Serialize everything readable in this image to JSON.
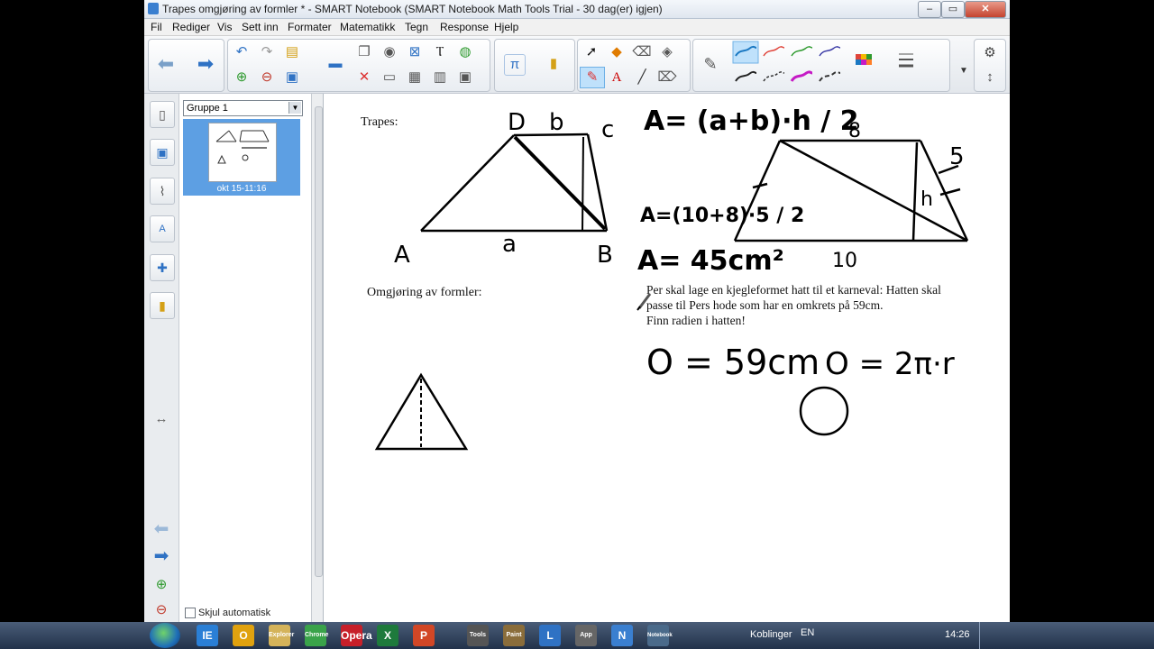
{
  "window": {
    "title": "Trapes omgjøring av formler * - SMART Notebook (SMART Notebook Math Tools Trial - 30 dag(er) igjen)",
    "controls": [
      "–",
      "▭",
      "✕"
    ]
  },
  "menu": [
    "Fil",
    "Rediger",
    "Vis",
    "Sett inn",
    "Formater",
    "Matematikk",
    "Tegn",
    "Response",
    "Hjelp"
  ],
  "toolbar": {
    "pen_colors": [
      "#1a78c2",
      "#e0443a",
      "#2e9a2e",
      "#3b3ba6",
      "#222222",
      "#c51ac5",
      "#333333"
    ]
  },
  "sidebar": {
    "group_select": "Gruppe 1",
    "thumbnail_label": "okt 15-11:16",
    "autohide_label": "Skjul automatisk"
  },
  "page": {
    "trapes_label": "Trapes:",
    "omgjoring_label": "Omgjøring av formler:",
    "problem_line1": "Per skal lage en kjegleformet hatt til et karneval: Hatten skal",
    "problem_line2": "passe til Pers hode som har en omkrets på 59cm.",
    "problem_line3": "Finn radien i hatten!",
    "hw_formula1": "A= (a+b)·h / 2",
    "hw_formula2": "A=(10+8)·5 / 2",
    "hw_result": "A= 45cm²",
    "hw_vertex_d": "D",
    "hw_vertex_b_top": "b",
    "hw_vertex_c": "c",
    "hw_vertex_a": "A",
    "hw_side_a": "a",
    "hw_vertex_b": "B",
    "hw_dim_top": "8",
    "hw_dim_side": "5",
    "hw_dim_h": "h",
    "hw_dim_bottom": "10",
    "hw_circ1": "O = 59cm",
    "hw_circ2": "O = 2π·r"
  },
  "taskbar": {
    "language": "EN",
    "links_label": "Koblinger",
    "clock": "14:26",
    "items": [
      "IE",
      "O",
      "Explorer",
      "Chrome",
      "Opera",
      "X",
      "P",
      "Tools",
      "Paint",
      "L",
      "App",
      "N",
      "Notebook"
    ]
  }
}
